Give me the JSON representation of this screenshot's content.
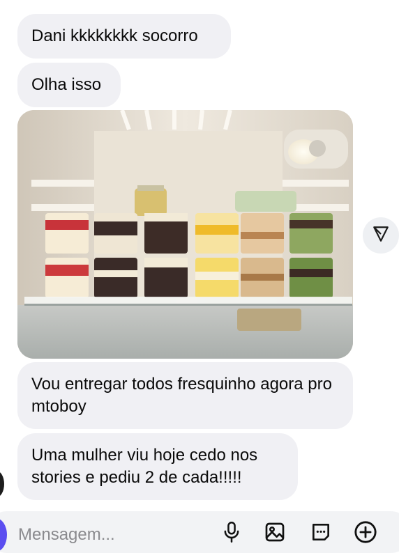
{
  "messages": [
    {
      "text": "Dani kkkkkkkk socorro"
    },
    {
      "text": "Olha isso"
    },
    {
      "text": "Vou entregar todos fresquinho agora pro mtoboy"
    },
    {
      "text": "Uma mulher viu hoje cedo nos stories e pediu 2 de cada!!!!!"
    }
  ],
  "composer": {
    "placeholder": "Mensagem..."
  },
  "icons": {
    "share": "share-icon",
    "mic": "microphone-icon",
    "gallery": "image-icon",
    "sticker": "sticker-icon",
    "add": "plus-circle-icon"
  },
  "colors": {
    "bubble_bg": "#f0f0f4",
    "composer_bg": "#f2f3f5",
    "camera_button": "#5b4ef0"
  }
}
